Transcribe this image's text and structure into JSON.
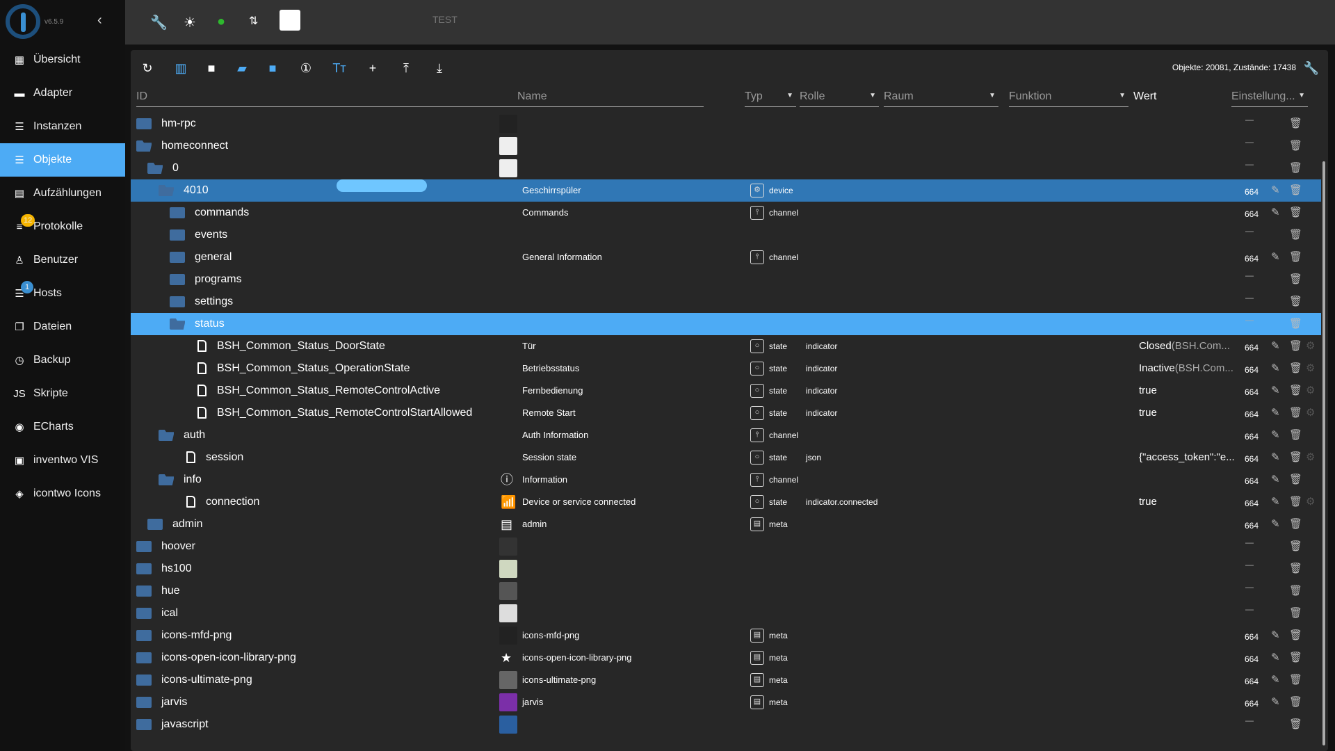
{
  "app": {
    "version": "v6.5.9",
    "host_label": "TEST"
  },
  "sidebar": {
    "items": [
      {
        "label": "Übersicht",
        "icon": "grid-icon"
      },
      {
        "label": "Adapter",
        "icon": "store-icon"
      },
      {
        "label": "Instanzen",
        "icon": "instances-icon"
      },
      {
        "label": "Objekte",
        "icon": "list-icon",
        "active": true
      },
      {
        "label": "Aufzählungen",
        "icon": "enum-icon"
      },
      {
        "label": "Protokolle",
        "icon": "log-icon",
        "badge": "12",
        "badge_color": "#f5b400"
      },
      {
        "label": "Benutzer",
        "icon": "user-icon"
      },
      {
        "label": "Hosts",
        "icon": "hosts-icon",
        "badge": "1",
        "badge_color": "#3a8fd1"
      },
      {
        "label": "Dateien",
        "icon": "files-icon"
      },
      {
        "label": "Backup",
        "icon": "backup-icon"
      },
      {
        "label": "Skripte",
        "icon": "js-icon"
      },
      {
        "label": "ECharts",
        "icon": "echarts-icon"
      },
      {
        "label": "inventwo VIS",
        "icon": "inventwo-icon"
      },
      {
        "label": "icontwo Icons",
        "icon": "icontwo-icon"
      }
    ]
  },
  "toolbar": {
    "stats": "Objekte: 20081, Zustände: 17438"
  },
  "columns": {
    "id": "ID",
    "name": "Name",
    "type": "Typ",
    "role": "Rolle",
    "room": "Raum",
    "function": "Funktion",
    "value": "Wert",
    "settings": "Einstellung..."
  },
  "rows": [
    {
      "id": "hm-rpc",
      "depth": 0,
      "icon": "folder",
      "nimg": "#222"
    },
    {
      "id": "homeconnect",
      "depth": 0,
      "icon": "folder-open",
      "nimg": "#eee"
    },
    {
      "id": "0",
      "depth": 1,
      "icon": "folder-open",
      "nimg": "#eee"
    },
    {
      "id": "4010",
      "depth": 2,
      "icon": "folder-open",
      "name": "Geschirrspüler",
      "type": "device",
      "acl": "664",
      "edit": true,
      "sel": 1,
      "redacted": true
    },
    {
      "id": "commands",
      "depth": 3,
      "icon": "folder",
      "name": "Commands",
      "type": "channel",
      "acl": "664",
      "edit": true
    },
    {
      "id": "events",
      "depth": 3,
      "icon": "folder"
    },
    {
      "id": "general",
      "depth": 3,
      "icon": "folder",
      "name": "General Information",
      "type": "channel",
      "acl": "664",
      "edit": true
    },
    {
      "id": "programs",
      "depth": 3,
      "icon": "folder"
    },
    {
      "id": "settings",
      "depth": 3,
      "icon": "folder"
    },
    {
      "id": "status",
      "depth": 3,
      "icon": "folder-open",
      "sel": 2
    },
    {
      "id": "BSH_Common_Status_DoorState",
      "depth": 4,
      "icon": "file",
      "name": "Tür",
      "type": "state",
      "role": "indicator",
      "value": "Closed",
      "value_suffix": "(BSH.Com...",
      "acl": "664",
      "edit": true,
      "gear": true
    },
    {
      "id": "BSH_Common_Status_OperationState",
      "depth": 4,
      "icon": "file",
      "name": "Betriebsstatus",
      "type": "state",
      "role": "indicator",
      "value": "Inactive",
      "value_suffix": "(BSH.Com...",
      "acl": "664",
      "edit": true,
      "gear": true
    },
    {
      "id": "BSH_Common_Status_RemoteControlActive",
      "depth": 4,
      "icon": "file",
      "name": "Fernbedienung",
      "type": "state",
      "role": "indicator",
      "value": "true",
      "acl": "664",
      "edit": true,
      "gear": true
    },
    {
      "id": "BSH_Common_Status_RemoteControlStartAllowed",
      "depth": 4,
      "icon": "file",
      "name": "Remote Start",
      "type": "state",
      "role": "indicator",
      "value": "true",
      "acl": "664",
      "edit": true,
      "gear": true
    },
    {
      "id": "auth",
      "depth": 2,
      "icon": "folder-open",
      "name": "Auth Information",
      "type": "channel",
      "acl": "664",
      "edit": true
    },
    {
      "id": "session",
      "depth": 3,
      "icon": "file-lock",
      "name": "Session state",
      "type": "state",
      "role": "json",
      "value": "{\"access_token\":\"e...",
      "acl": "664",
      "edit": true,
      "gear": true
    },
    {
      "id": "info",
      "depth": 2,
      "icon": "folder-open",
      "name": "Information",
      "nicon": "ⓘ",
      "type": "channel",
      "acl": "664",
      "edit": true
    },
    {
      "id": "connection",
      "depth": 3,
      "icon": "file-lock",
      "name": "Device or service connected",
      "nicon": "📶",
      "type": "state",
      "role": "indicator.connected",
      "value": "true",
      "acl": "664",
      "edit": true,
      "gear": true
    },
    {
      "id": "admin",
      "depth": 1,
      "icon": "folder",
      "name": "admin",
      "nicon": "▤",
      "type": "meta",
      "acl": "664",
      "edit": true
    },
    {
      "id": "hoover",
      "depth": 0,
      "icon": "folder",
      "nimg": "#333"
    },
    {
      "id": "hs100",
      "depth": 0,
      "icon": "folder",
      "nimg": "#cfd8c0"
    },
    {
      "id": "hue",
      "depth": 0,
      "icon": "folder",
      "nimg": "#555"
    },
    {
      "id": "ical",
      "depth": 0,
      "icon": "folder",
      "nimg": "#ddd"
    },
    {
      "id": "icons-mfd-png",
      "depth": 0,
      "icon": "folder",
      "name": "icons-mfd-png",
      "nimg": "#222",
      "type": "meta",
      "acl": "664",
      "edit": true
    },
    {
      "id": "icons-open-icon-library-png",
      "depth": 0,
      "icon": "folder",
      "name": "icons-open-icon-library-png",
      "nicon": "★",
      "type": "meta",
      "acl": "664",
      "edit": true
    },
    {
      "id": "icons-ultimate-png",
      "depth": 0,
      "icon": "folder",
      "name": "icons-ultimate-png",
      "nimg": "#666",
      "type": "meta",
      "acl": "664",
      "edit": true
    },
    {
      "id": "jarvis",
      "depth": 0,
      "icon": "folder",
      "name": "jarvis",
      "nimg": "#7b2fa8",
      "type": "meta",
      "acl": "664",
      "edit": true
    },
    {
      "id": "javascript",
      "depth": 0,
      "icon": "folder",
      "nimg": "#2a5fa0"
    }
  ]
}
